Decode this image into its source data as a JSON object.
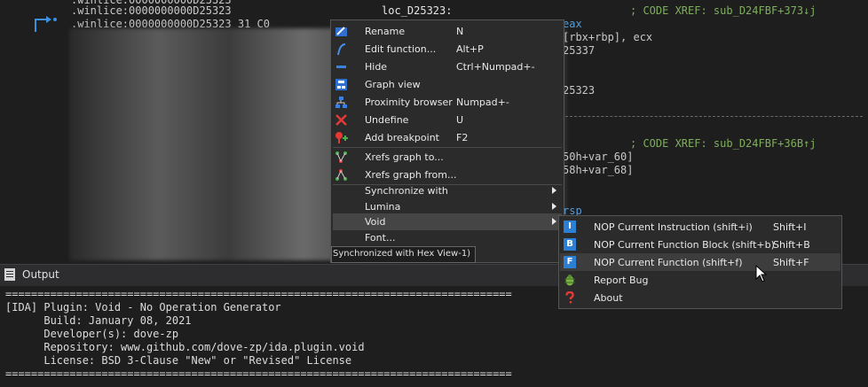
{
  "disasm": {
    "lines": [
      {
        "addr": ".winlice:0000000000D25323",
        "label": "loc_D25323:",
        "comment": "; CODE XREF: sub_D24FBF+373↓j"
      },
      {
        "addr": ".winlice:0000000000D25323 31 C0",
        "frag": "eax"
      },
      {
        "frag": "[rbx+rbp], ecx"
      },
      {
        "frag": "25337"
      },
      {
        "frag": "25323"
      },
      {
        "comment": "; CODE XREF: sub_D24FBF+36B↑j"
      },
      {
        "frag": "50h+var_60]"
      },
      {
        "frag": "58h+var_68]"
      },
      {
        "frag": "rsp"
      }
    ]
  },
  "context_menu": {
    "items": [
      {
        "label": "Rename",
        "shortcut": "N",
        "icon": "rename-icon"
      },
      {
        "label": "Edit function...",
        "shortcut": "Alt+P",
        "icon": "edit-function-icon"
      },
      {
        "label": "Hide",
        "shortcut": "Ctrl+Numpad+-",
        "icon": "hide-icon"
      },
      {
        "label": "Graph view",
        "shortcut": "",
        "icon": "graph-view-icon"
      },
      {
        "label": "Proximity browser",
        "shortcut": "Numpad+-",
        "icon": "proximity-icon"
      },
      {
        "label": "Undefine",
        "shortcut": "U",
        "icon": "undefine-icon"
      },
      {
        "label": "Add breakpoint",
        "shortcut": "F2",
        "icon": "breakpoint-icon"
      },
      {
        "label": "Xrefs graph to...",
        "shortcut": "",
        "icon": "xrefs-to-icon"
      },
      {
        "label": "Xrefs graph from...",
        "shortcut": "",
        "icon": "xrefs-from-icon"
      },
      {
        "label": "Synchronize with",
        "shortcut": "",
        "icon": ""
      },
      {
        "label": "Lumina",
        "shortcut": "",
        "icon": ""
      },
      {
        "label": "Void",
        "shortcut": "",
        "icon": ""
      },
      {
        "label": "Font...",
        "shortcut": "",
        "icon": ""
      }
    ],
    "status": "Synchronized with Hex View-1)"
  },
  "submenu": {
    "items": [
      {
        "badge": "I",
        "label": "NOP Current Instruction (shift+i)",
        "shortcut": "Shift+I"
      },
      {
        "badge": "B",
        "label": "NOP Current Function Block (shift+b)",
        "shortcut": "Shift+B"
      },
      {
        "badge": "F",
        "label": "NOP Current Function (shift+f)",
        "shortcut": "Shift+F"
      },
      {
        "badge": "",
        "label": "Report Bug",
        "shortcut": ""
      },
      {
        "badge": "",
        "label": "About",
        "shortcut": ""
      }
    ]
  },
  "output": {
    "title": "Output",
    "lines": [
      "===============================================================================",
      "[IDA] Plugin: Void - No Operation Generator",
      "      Build: January 08, 2021",
      "      Developer(s): dove-zp",
      "      Repository: www.github.com/dove-zp/ida.plugin.void",
      "      License: BSD 3-Clause \"New\" or \"Revised\" License",
      "==============================================================================="
    ]
  },
  "colors": {
    "accent": "#2d7fd4",
    "comment": "#7fae5c",
    "keyword": "#569cd6",
    "background": "#1e1e1e"
  }
}
